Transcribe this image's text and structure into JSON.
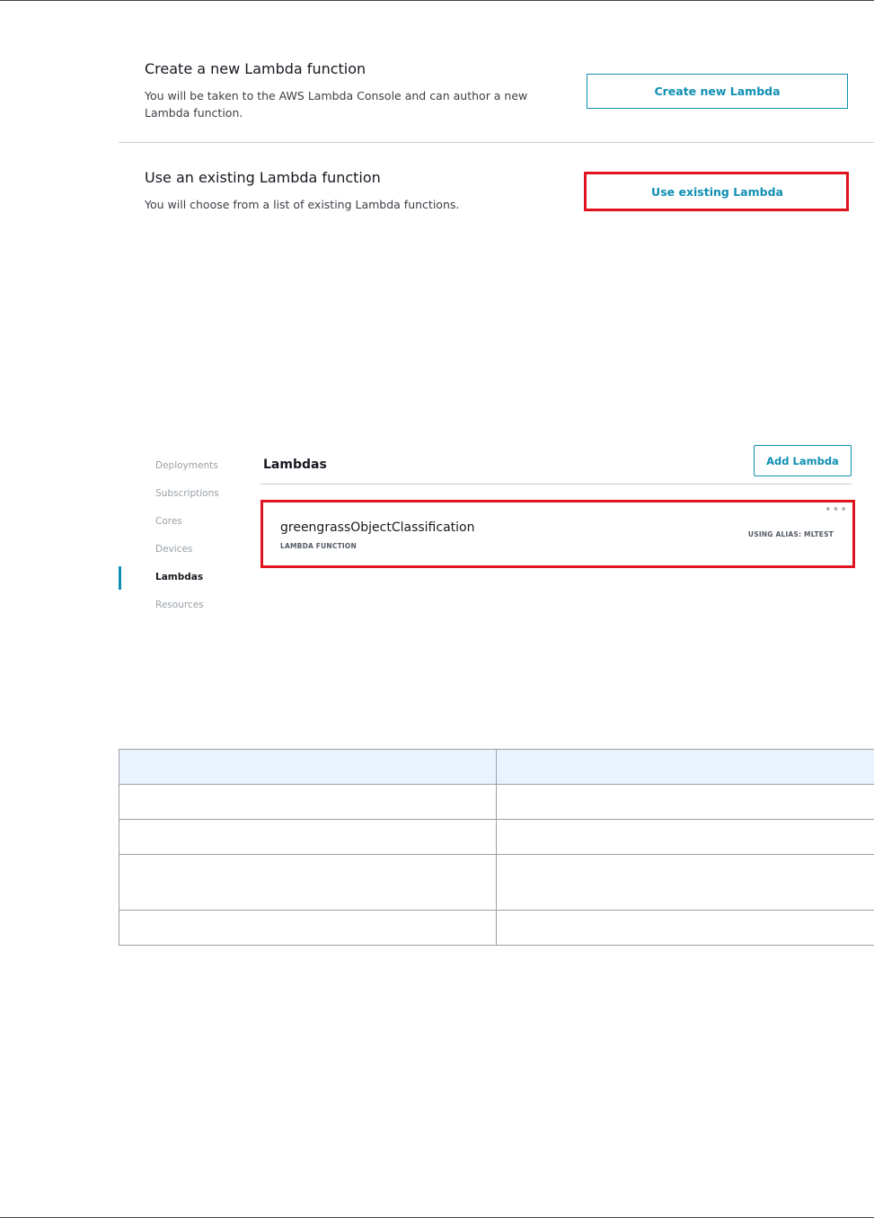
{
  "create_option": {
    "title": "Create a new Lambda function",
    "description": "You will be taken to the AWS Lambda Console and can author a new Lambda function.",
    "button_label": "Create new Lambda"
  },
  "existing_option": {
    "title": "Use an existing Lambda function",
    "description": "You will choose from a list of existing Lambda functions.",
    "button_label": "Use existing Lambda"
  },
  "highlight_color": "#e0131f",
  "accent_color": "#0f8fb3",
  "group_console": {
    "nav": [
      {
        "label": "Deployments",
        "active": false
      },
      {
        "label": "Subscriptions",
        "active": false
      },
      {
        "label": "Cores",
        "active": false
      },
      {
        "label": "Devices",
        "active": false
      },
      {
        "label": "Lambdas",
        "active": true
      },
      {
        "label": "Resources",
        "active": false
      }
    ],
    "section_title": "Lambdas",
    "add_button_label": "Add Lambda",
    "lambda_card": {
      "name": "greengrassObjectClassification",
      "type": "LAMBDA FUNCTION",
      "alias": "USING ALIAS: MLTEST",
      "menu_icon": "more-horizontal-icon"
    }
  },
  "table": {
    "header": [
      "",
      ""
    ],
    "rows": [
      [
        "",
        ""
      ],
      [
        "",
        ""
      ],
      [
        "",
        ""
      ],
      [
        "",
        ""
      ]
    ]
  }
}
